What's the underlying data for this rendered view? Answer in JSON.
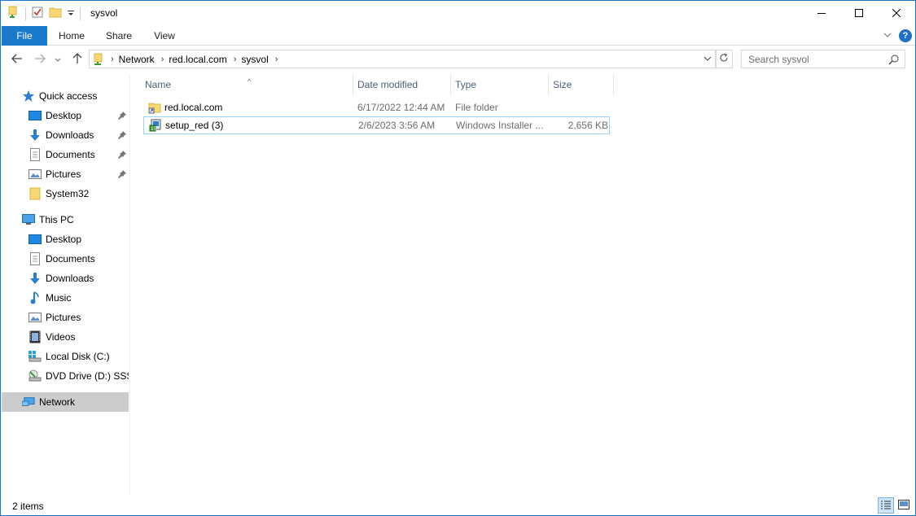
{
  "window": {
    "title": "sysvol"
  },
  "ribbon": {
    "tabs": [
      "File",
      "Home",
      "Share",
      "View"
    ]
  },
  "address": {
    "breadcrumbs": [
      "Network",
      "red.local.com",
      "sysvol"
    ]
  },
  "search": {
    "placeholder": "Search sysvol"
  },
  "nav": {
    "quick_access": {
      "label": "Quick access",
      "items": [
        {
          "label": "Desktop",
          "icon": "desktop-icon",
          "pinned": true
        },
        {
          "label": "Downloads",
          "icon": "download-icon",
          "pinned": true
        },
        {
          "label": "Documents",
          "icon": "document-icon",
          "pinned": true
        },
        {
          "label": "Pictures",
          "icon": "picture-icon",
          "pinned": true
        },
        {
          "label": "System32",
          "icon": "folder-icon",
          "pinned": false
        }
      ]
    },
    "this_pc": {
      "label": "This PC",
      "items": [
        {
          "label": "Desktop",
          "icon": "desktop-icon"
        },
        {
          "label": "Documents",
          "icon": "document-icon"
        },
        {
          "label": "Downloads",
          "icon": "download-icon"
        },
        {
          "label": "Music",
          "icon": "music-icon"
        },
        {
          "label": "Pictures",
          "icon": "picture-icon"
        },
        {
          "label": "Videos",
          "icon": "video-icon"
        },
        {
          "label": "Local Disk (C:)",
          "icon": "drive-icon"
        },
        {
          "label": "DVD Drive (D:) SSS_X",
          "icon": "dvd-icon"
        }
      ]
    },
    "network": {
      "label": "Network"
    }
  },
  "columns": {
    "name": "Name",
    "date": "Date modified",
    "type": "Type",
    "size": "Size"
  },
  "files": [
    {
      "name": "red.local.com",
      "date": "6/17/2022 12:44 AM",
      "type": "File folder",
      "size": "",
      "icon": "folder-shortcut-icon"
    },
    {
      "name": "setup_red (3)",
      "date": "2/6/2023 3:56 AM",
      "type": "Windows Installer ...",
      "size": "2,656 KB",
      "icon": "installer-icon"
    }
  ],
  "status": {
    "item_count": "2 items"
  },
  "colors": {
    "accent": "#1979ca",
    "selection_border": "#99d1ff",
    "nav_selected": "#cccccc",
    "header_text": "#4c607a"
  }
}
